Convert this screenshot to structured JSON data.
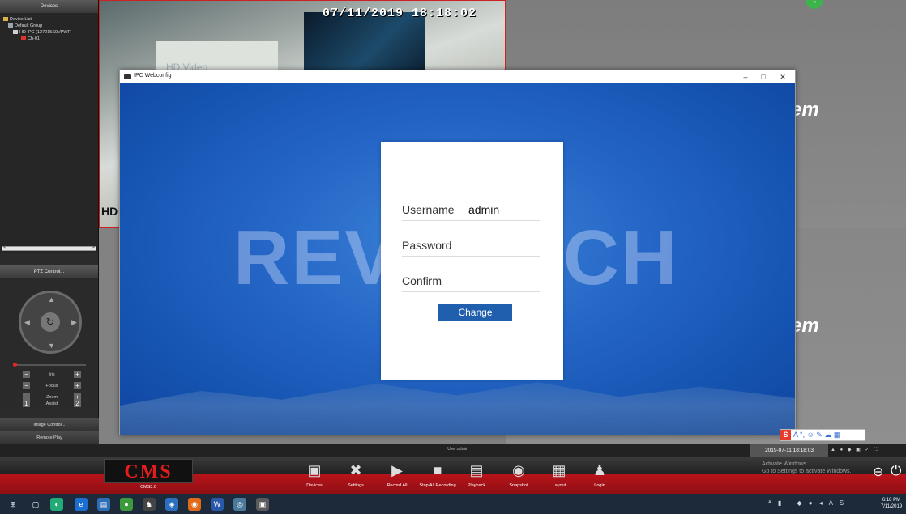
{
  "left_panel": {
    "devices_title": "Devices",
    "tree": [
      {
        "label": "Device List",
        "level": 0
      },
      {
        "label": "Default Group",
        "level": 1
      },
      {
        "label": "HD IPC (127215S9VPWF",
        "level": 2
      },
      {
        "label": "Ch-01",
        "level": 3
      }
    ],
    "ptz_title": "PTZ Control...",
    "controls": [
      {
        "label": "Iris",
        "minus": "−",
        "plus": "+"
      },
      {
        "label": "Focus",
        "minus": "−",
        "plus": "+"
      },
      {
        "label": "Zoom",
        "minus": "−",
        "plus": "+"
      },
      {
        "label": "Assist",
        "minus": "1",
        "plus": "2"
      }
    ],
    "image_control": "Image Control...",
    "remote_play": "Remote Play"
  },
  "video": {
    "timestamp": "07/11/2019 18:18:02",
    "corner_text": "HD",
    "wall_sign": "HD Video",
    "logo_fragment_1": "em",
    "logo_fragment_2": "em"
  },
  "webconfig": {
    "title": "IPC Webconfig",
    "controls": {
      "minimize": "–",
      "maximize": "□",
      "close": "✕"
    },
    "watermark": "REVOTECH",
    "form": {
      "username_label": "Username",
      "username_value": "admin",
      "password_label": "Password",
      "confirm_label": "Confirm",
      "change_button": "Change"
    }
  },
  "ime_toolbar": {
    "brand": "S",
    "icons": "A °, ☺ ✎ ☁ ▦"
  },
  "status_bar": {
    "user": "User:admin",
    "datetime": "2019-07-11 18:18:03",
    "activate_line1": "Activate Windows",
    "activate_line2": "Go to Settings to activate Windows."
  },
  "cms_bar": {
    "logo": "CMS",
    "version": "CMS3.0",
    "buttons": [
      {
        "label": "Devices",
        "icon": "devices-icon",
        "glyph": "▣"
      },
      {
        "label": "Settings",
        "icon": "settings-icon",
        "glyph": "✖"
      },
      {
        "label": "Record All",
        "icon": "record-all-icon",
        "glyph": "▶"
      },
      {
        "label": "Stop All Recording",
        "icon": "stop-recording-icon",
        "glyph": "■"
      },
      {
        "label": "Playback",
        "icon": "playback-icon",
        "glyph": "▤"
      },
      {
        "label": "Snapshot",
        "icon": "camera-icon",
        "glyph": "◉"
      },
      {
        "label": "Layout",
        "icon": "layout-icon",
        "glyph": "▦"
      },
      {
        "label": "Login",
        "icon": "login-icon",
        "glyph": "♟"
      }
    ]
  },
  "taskbar": {
    "clock_time": "6:18 PM",
    "clock_date": "7/11/2019"
  }
}
